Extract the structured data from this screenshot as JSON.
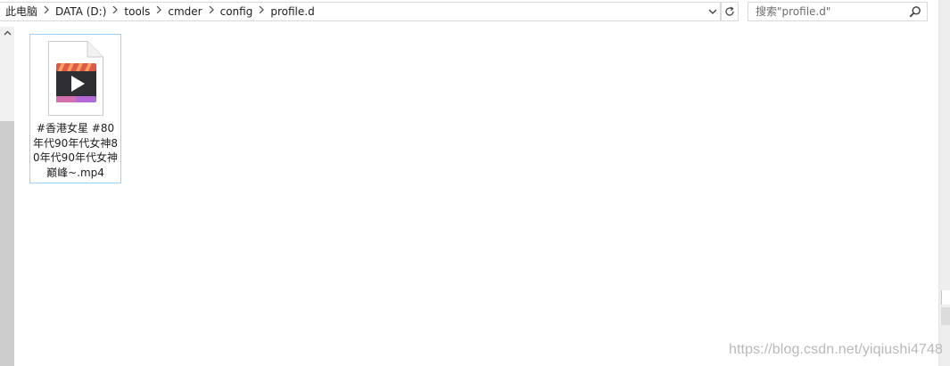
{
  "breadcrumb": {
    "items": [
      "此电脑",
      "DATA (D:)",
      "tools",
      "cmder",
      "config",
      "profile.d"
    ],
    "separator_icon": "chevron-right-icon"
  },
  "address_bar": {
    "dropdown_icon": "chevron-down-icon",
    "refresh_icon": "refresh-icon"
  },
  "search": {
    "placeholder": "搜索\"profile.d\"",
    "icon": "search-icon"
  },
  "nav_pane": {
    "scroll_up_icon": "chevron-up-icon"
  },
  "files": [
    {
      "name": "#香港女星 #80年代90年代女神80年代90年代女神巅峰~.mp4",
      "icon": "video-file-icon",
      "selected": true
    }
  ],
  "watermark": "https://blog.csdn.net/yiqiushi4748",
  "colors": {
    "selection_border": "#99d1ff",
    "text": "#1e1e1e",
    "border": "#d9d9d9",
    "watermark": "#b9b9b9",
    "scrollbar_track": "#cdcdcd"
  }
}
